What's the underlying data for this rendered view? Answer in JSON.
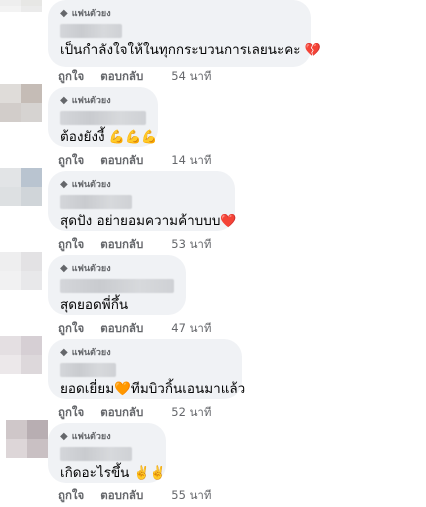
{
  "comments": [
    {
      "badge": "แฟนตัวยง",
      "text": "เป็นกำลังใจให้ในทุกกระบวนการเลยนะคะ",
      "emoji": "💔",
      "like": "ถูกใจ",
      "reply": "ตอบกลับ",
      "time": "54 นาที"
    },
    {
      "badge": "แฟนตัวยง",
      "text": "ต้องยังงี้",
      "emoji": "💪💪💪",
      "like": "ถูกใจ",
      "reply": "ตอบกลับ",
      "time": "14 นาที"
    },
    {
      "badge": "แฟนตัวยง",
      "text": "สุดปัง อย่ายอมความค้าบบบ",
      "emoji": "❤️",
      "like": "ถูกใจ",
      "reply": "ตอบกลับ",
      "time": "53 นาที"
    },
    {
      "badge": "แฟนตัวยง",
      "text": "สุดยอดพี่กึ้น",
      "emoji": "",
      "like": "ถูกใจ",
      "reply": "ตอบกลับ",
      "time": "47 นาที"
    },
    {
      "badge": "แฟนตัวยง",
      "text": "ยอดเยี่ยม🧡ทีมบิวกิ้นเอนมาแล้ว",
      "emoji": "",
      "like": "ถูกใจ",
      "reply": "ตอบกลับ",
      "time": "52 นาที"
    },
    {
      "badge": "แฟนตัวยง",
      "text": "เกิดอะไรขึ้น",
      "emoji": "✌️✌️",
      "like": "ถูกใจ",
      "reply": "ตอบกลับ",
      "time": "55 นาที"
    }
  ],
  "colors": {
    "bubble": "#f0f2f5",
    "meta_text": "#65676b",
    "body_text": "#050505"
  },
  "icons": {
    "badge": "diamond-icon"
  }
}
